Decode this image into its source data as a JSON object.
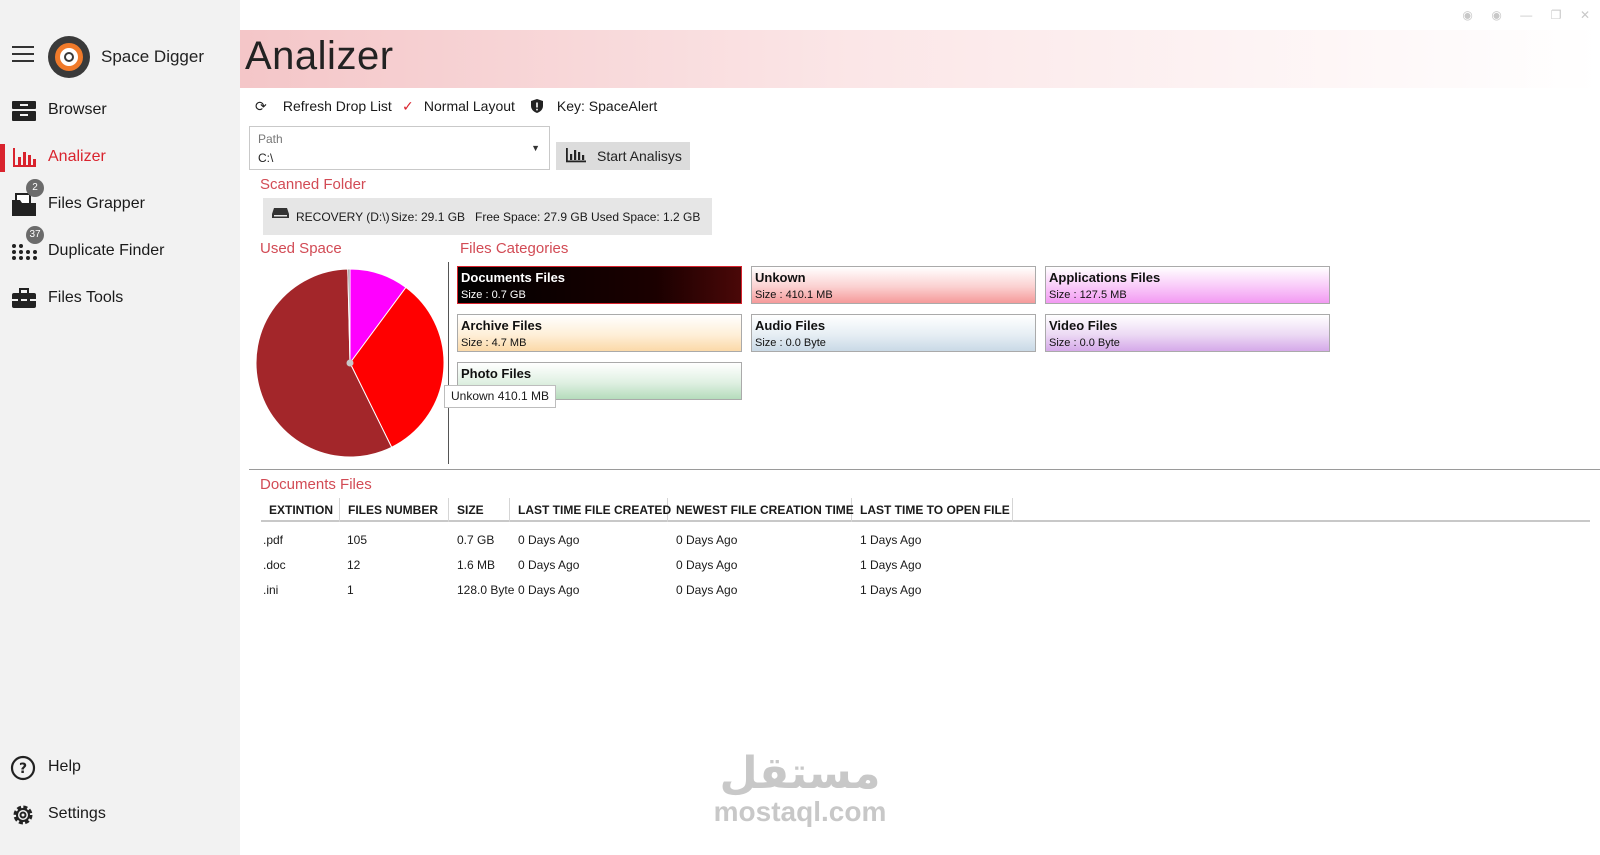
{
  "window": {
    "controls": [
      "◉",
      "◉",
      "—",
      "❐",
      "✕"
    ]
  },
  "app": {
    "title": "Space Digger"
  },
  "sidebar": {
    "items": [
      {
        "label": "Browser",
        "icon": "drawer-icon"
      },
      {
        "label": "Analizer",
        "icon": "bar-chart-icon",
        "active": true
      },
      {
        "label": "Files Grapper",
        "icon": "folder-files-icon",
        "badge": "2"
      },
      {
        "label": "Duplicate Finder",
        "icon": "dots-grid-icon",
        "badge": "37"
      },
      {
        "label": "Files Tools",
        "icon": "toolbox-icon"
      }
    ],
    "footer": [
      {
        "label": "Help",
        "icon": "help-icon"
      },
      {
        "label": "Settings",
        "icon": "gear-icon"
      }
    ]
  },
  "page": {
    "title": "Analizer",
    "header_color": "#f4c6c8"
  },
  "toolbar": {
    "refresh_label": "Refresh Drop List",
    "layout_label": "Normal Layout",
    "key_label": "Key: SpaceAlert"
  },
  "path": {
    "label": "Path",
    "value": "C:\\"
  },
  "start_button": {
    "label": "Start Analisys"
  },
  "scanned": {
    "title": "Scanned Folder",
    "drive": "RECOVERY (D:\\)",
    "size": "Size: 29.1 GB",
    "free": "Free Space: 27.9 GB",
    "used": "Used Space: 1.2 GB"
  },
  "used_space": {
    "title": "Used Space"
  },
  "categories": {
    "title": "Files Categories",
    "items": [
      {
        "name": "Documents Files",
        "size": "Size  : 0.7 GB",
        "color": "#000000"
      },
      {
        "name": "Unkown",
        "size": "Size  : 410.1 MB",
        "color": "#f8a0a0"
      },
      {
        "name": "Applications Files",
        "size": "Size  : 127.5 MB",
        "color": "#f5a6f5"
      },
      {
        "name": "Archive Files",
        "size": "Size  : 4.7 MB",
        "color": "#fde0b8"
      },
      {
        "name": "Audio Files",
        "size": "Size  : 0.0 Byte",
        "color": "#cfdde8"
      },
      {
        "name": "Video Files",
        "size": "Size  : 0.0 Byte",
        "color": "#d9b3ea"
      },
      {
        "name": "Photo Files",
        "size": "",
        "color": "#bfe2c5"
      }
    ]
  },
  "tooltip": {
    "text": "Unkown 410.1 MB"
  },
  "chart_data": {
    "type": "pie",
    "series": [
      {
        "name": "Documents Files",
        "value": 0.7,
        "unit": "GB",
        "color": "#a3262a"
      },
      {
        "name": "Unkown",
        "value": 410.1,
        "unit": "MB",
        "color": "#ff0000"
      },
      {
        "name": "Applications Files",
        "value": 127.5,
        "unit": "MB",
        "color": "#ff00ff"
      },
      {
        "name": "Archive Files",
        "value": 4.7,
        "unit": "MB",
        "color": "#808080"
      }
    ]
  },
  "table": {
    "title": "Documents Files",
    "columns": [
      "EXTINTION",
      "FILES NUMBER",
      "SIZE",
      "LAST TIME FILE CREATED",
      "NEWEST FILE CREATION TIME",
      "LAST TIME TO OPEN FILE"
    ],
    "rows": [
      [
        ".pdf",
        "105",
        "0.7 GB",
        "0  Days Ago",
        "0 Days Ago",
        "1 Days Ago"
      ],
      [
        ".doc",
        "12",
        "1.6 MB",
        "0  Days Ago",
        "0 Days Ago",
        "1 Days Ago"
      ],
      [
        ".ini",
        "1",
        "128.0 Byte",
        "0  Days Ago",
        "0 Days Ago",
        "1 Days Ago"
      ]
    ]
  },
  "watermark": {
    "arabic": "مستقل",
    "latin": "mostaql.com"
  }
}
